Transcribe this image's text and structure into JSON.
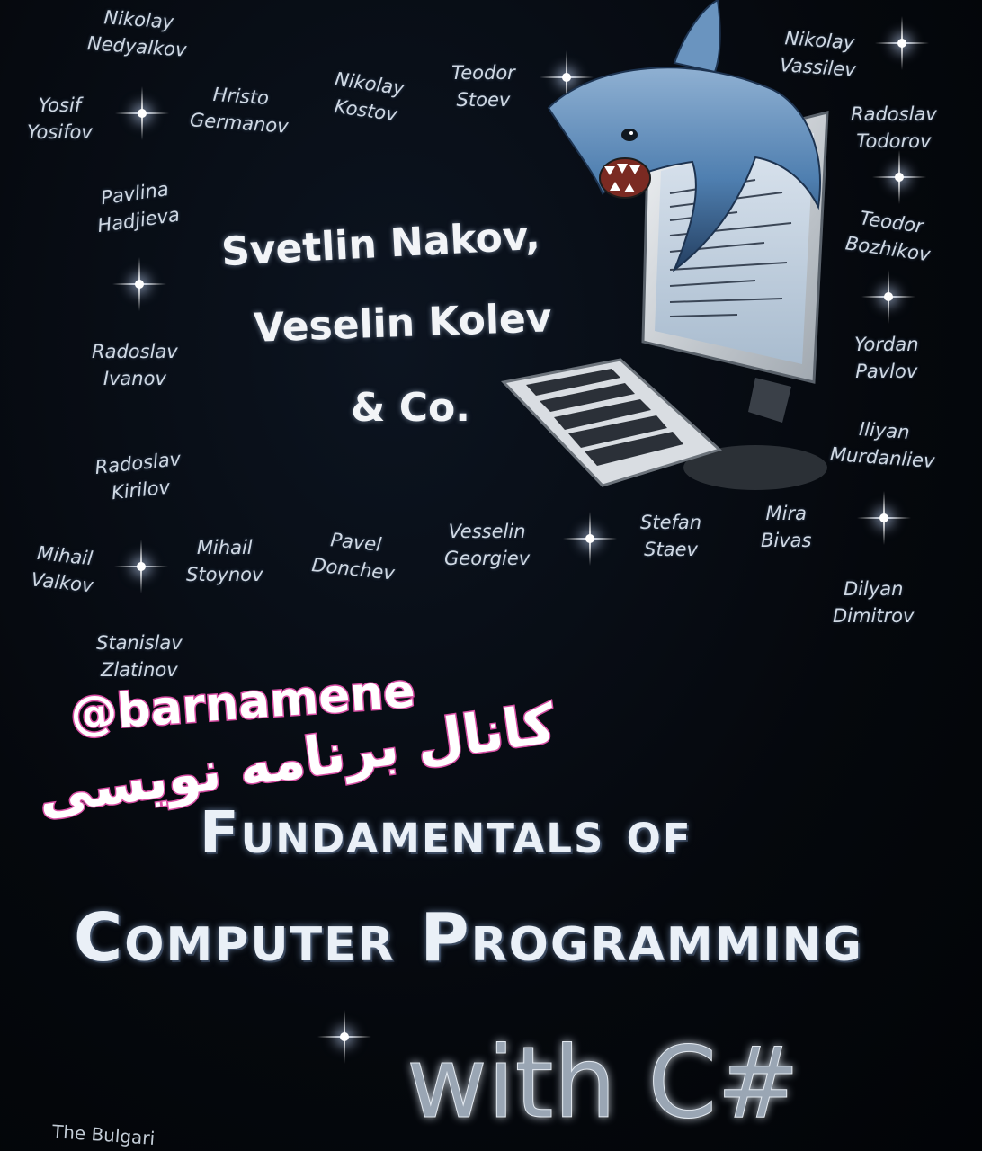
{
  "cover": {
    "contributors": [
      {
        "first": "Nikolay",
        "last": "Nedyalkov"
      },
      {
        "first": "Yosif",
        "last": "Yosifov"
      },
      {
        "first": "Hristo",
        "last": "Germanov"
      },
      {
        "first": "Nikolay",
        "last": "Kostov"
      },
      {
        "first": "Teodor",
        "last": "Stoev"
      },
      {
        "first": "Nikolay",
        "last": "Vassilev"
      },
      {
        "first": "Radoslav",
        "last": "Todorov"
      },
      {
        "first": "Pavlina",
        "last": "Hadjieva"
      },
      {
        "first": "Teodor",
        "last": "Bozhikov"
      },
      {
        "first": "Radoslav",
        "last": "Ivanov"
      },
      {
        "first": "Yordan",
        "last": "Pavlov"
      },
      {
        "first": "Iliyan",
        "last": "Murdanliev"
      },
      {
        "first": "Radoslav",
        "last": "Kirilov"
      },
      {
        "first": "Mihail",
        "last": "Valkov"
      },
      {
        "first": "Mihail",
        "last": "Stoynov"
      },
      {
        "first": "Pavel",
        "last": "Donchev"
      },
      {
        "first": "Vesselin",
        "last": "Georgiev"
      },
      {
        "first": "Stefan",
        "last": "Staev"
      },
      {
        "first": "Mira",
        "last": "Bivas"
      },
      {
        "first": "Dilyan",
        "last": "Dimitrov"
      },
      {
        "first": "Stanislav",
        "last": "Zlatinov"
      }
    ],
    "authors": {
      "line1": "Svetlin Nakov,",
      "line2": "Veselin Kolev",
      "line3": "& Co."
    },
    "title": {
      "line1": "Fundamentals of",
      "line2": "Computer Programming",
      "line3": "with C#"
    },
    "publisher_fragment": "The Bulgari",
    "icons": [
      "shark-icon",
      "computer-monitor-icon",
      "keyboard-icon",
      "star-icon"
    ]
  },
  "overlay": {
    "handle": "@barnamene",
    "channel_text": "کانال برنامه نویسی",
    "accent_color": "#d94fa5"
  },
  "colors": {
    "background": "#05080d",
    "text": "#cfd8e3"
  }
}
